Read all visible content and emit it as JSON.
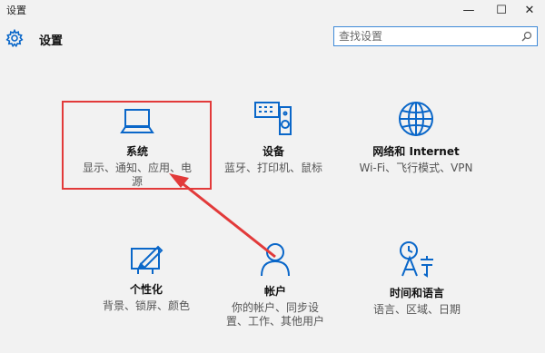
{
  "window": {
    "title": "设置",
    "minimize": "—",
    "maximize": "☐",
    "close": "✕"
  },
  "header": {
    "title": "设置",
    "icon": "gear-icon"
  },
  "search": {
    "placeholder": "查找设置",
    "icon": "search-icon"
  },
  "accent_color": "#0a67c9",
  "highlight_color": "#e23a3a",
  "tiles": [
    {
      "name": "系统",
      "desc": "显示、通知、应用、电源",
      "icon": "laptop-icon"
    },
    {
      "name": "设备",
      "desc": "蓝牙、打印机、鼠标",
      "icon": "devices-icon"
    },
    {
      "name": "网络和 Internet",
      "desc": "Wi-Fi、飞行模式、VPN",
      "icon": "globe-icon"
    },
    {
      "name": "个性化",
      "desc": "背景、锁屏、颜色",
      "icon": "personalization-icon"
    },
    {
      "name": "帐户",
      "desc": "你的帐户、同步设置、工作、其他用户",
      "icon": "person-icon"
    },
    {
      "name": "时间和语言",
      "desc": "语言、区域、日期",
      "icon": "time-language-icon"
    }
  ]
}
